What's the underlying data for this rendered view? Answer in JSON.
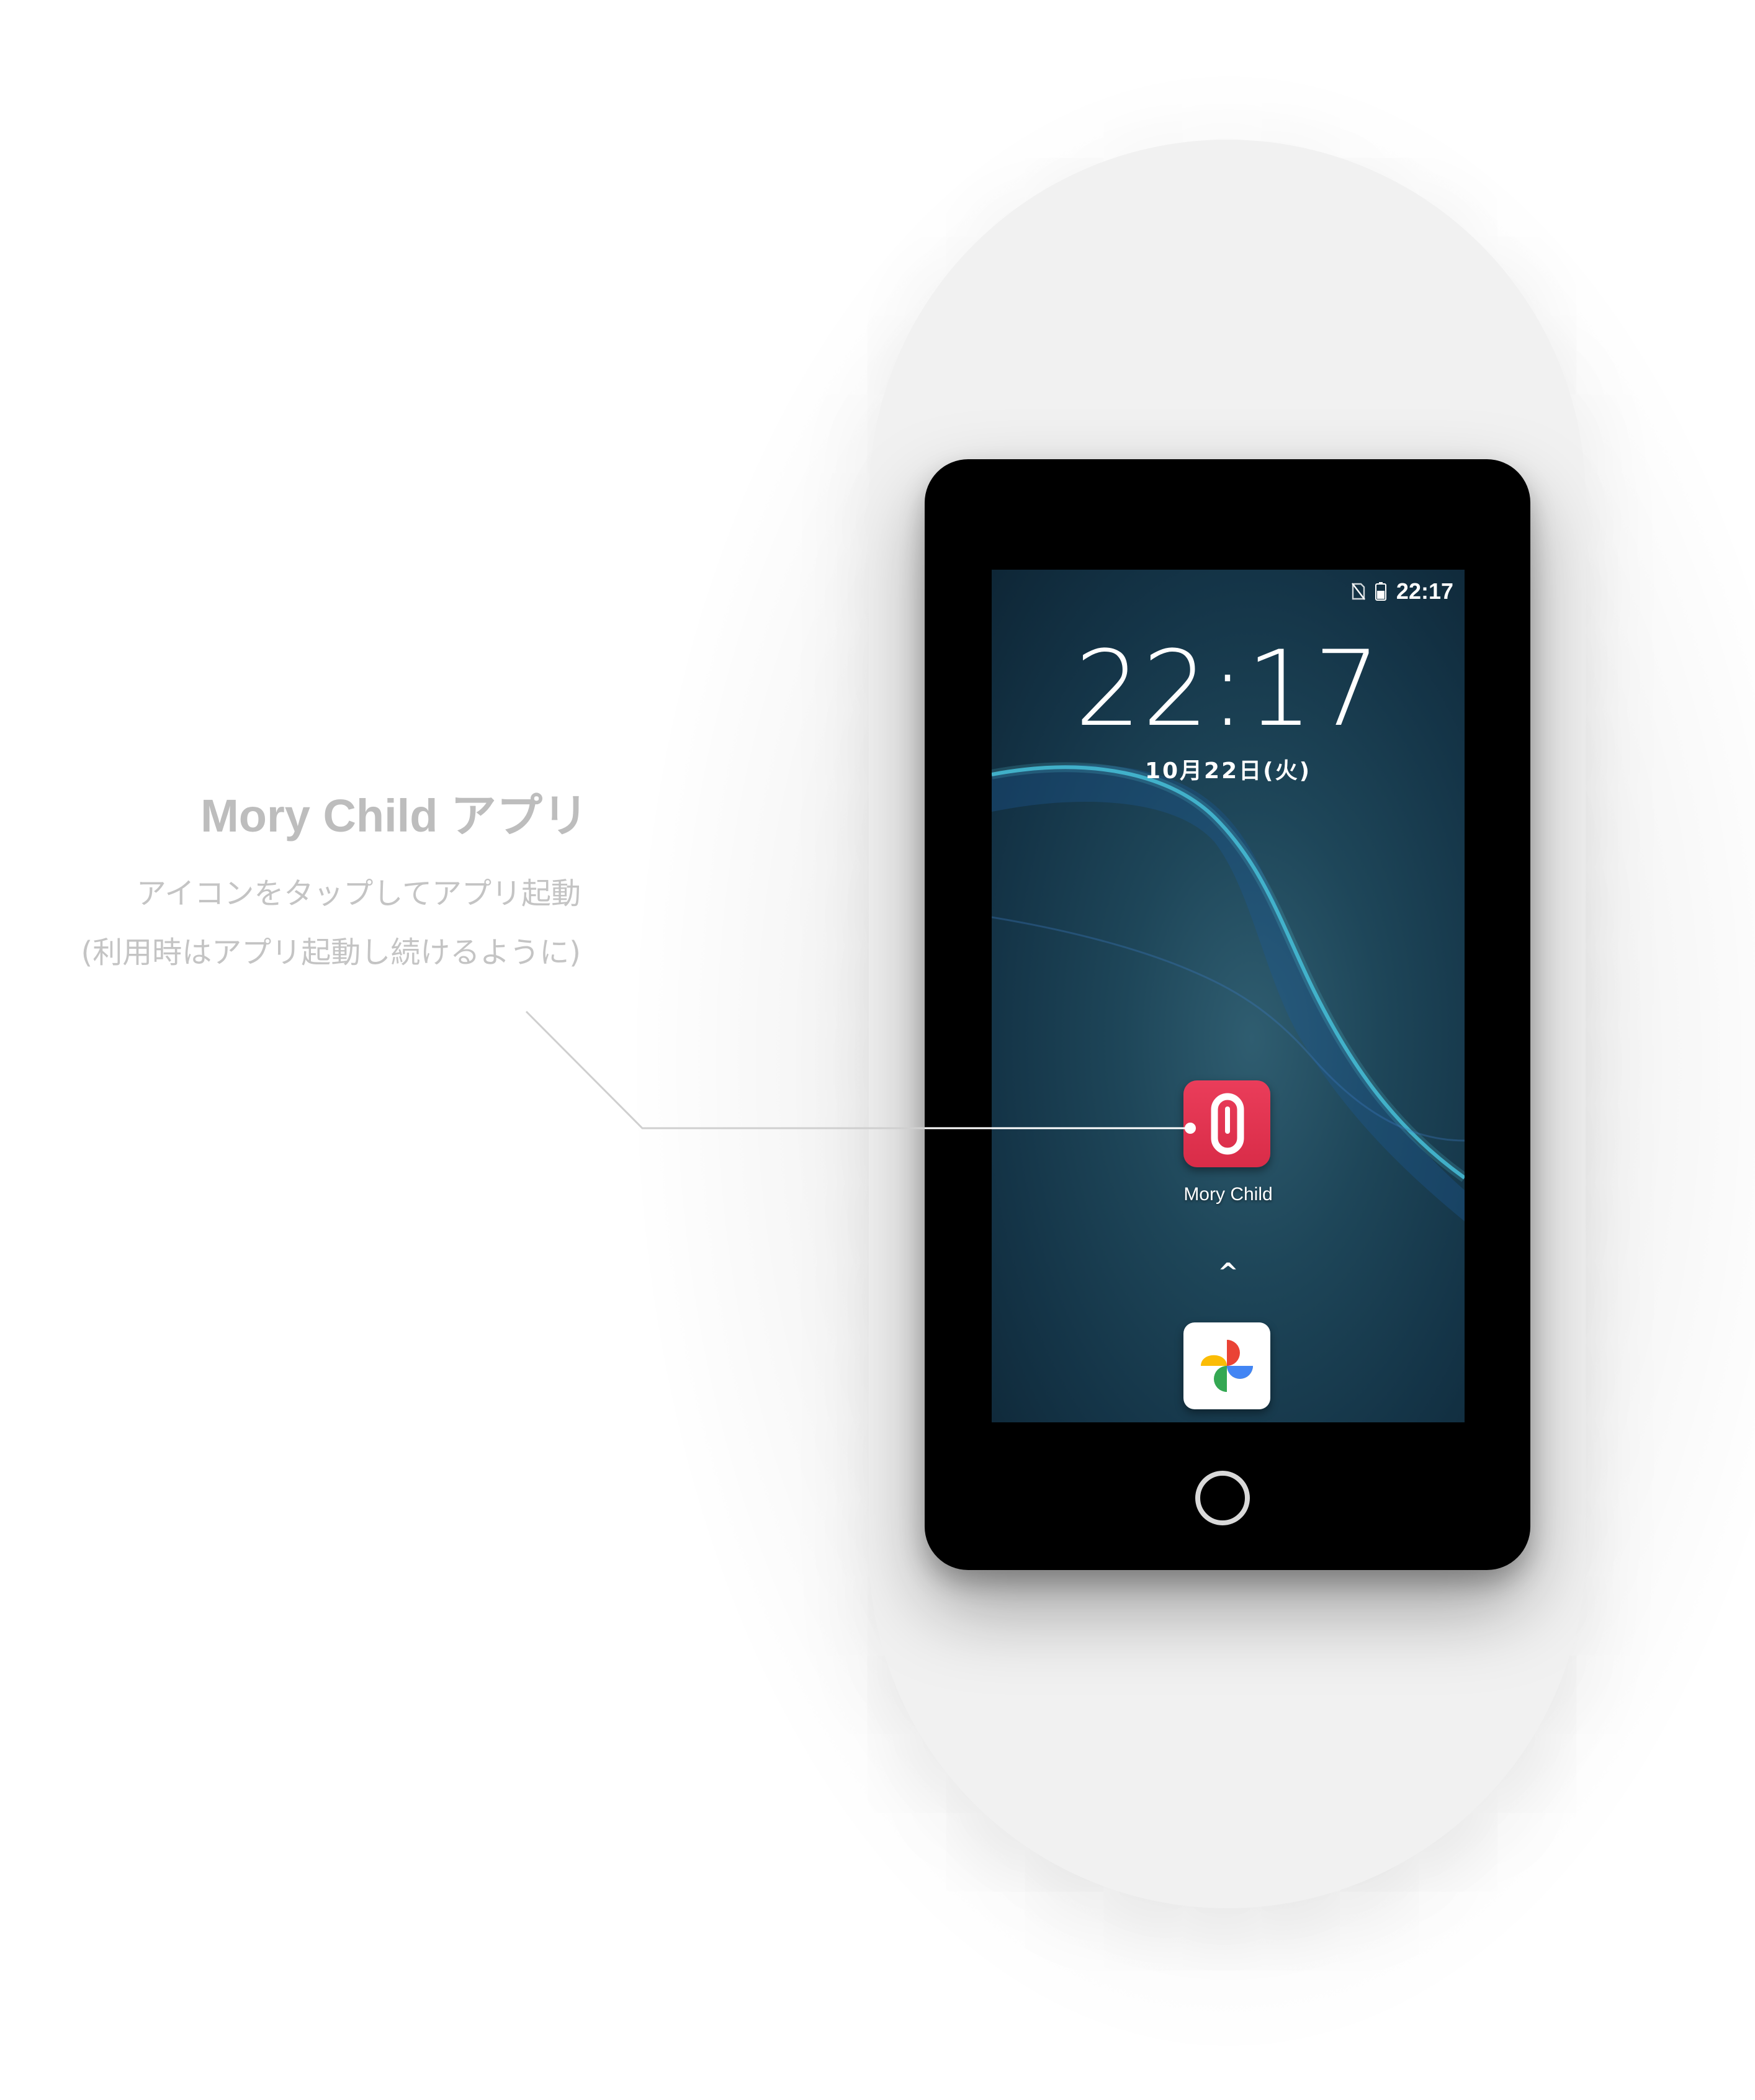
{
  "callout": {
    "title": "Mory Child アプリ",
    "line1": "アイコンをタップしてアプリ起動",
    "line2": "(利用時はアプリ起動し続けるように)"
  },
  "status_bar": {
    "time": "22:17",
    "icons": [
      "no-sim-icon",
      "battery-icon"
    ]
  },
  "lock_screen": {
    "clock": "22:17",
    "date": "10月22日(火)"
  },
  "apps": [
    {
      "label": "Mory Child",
      "icon": "mory-child-icon",
      "color": "#e23450"
    },
    {
      "label": "",
      "icon": "google-photos-icon"
    }
  ],
  "drawer_handle": "^",
  "colors": {
    "accent": "#e23450",
    "wave": "#4fc3d8",
    "callout_text": "#bdbdbd"
  }
}
